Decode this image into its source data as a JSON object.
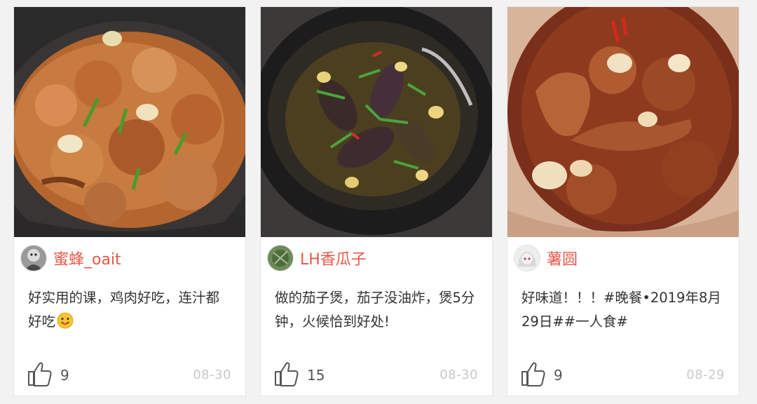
{
  "posts": [
    {
      "author": "蜜蜂_oait",
      "caption": "好实用的课，鸡肉好吃，连汁都好吃",
      "emoji": "grinning-emoji",
      "likes": "9",
      "date": "08-30",
      "photo": "chicken-claypot-photo"
    },
    {
      "author": "LH香瓜子",
      "caption": "做的茄子煲，茄子没油炸，煲5分钟，火候恰到好处!",
      "likes": "15",
      "date": "08-30",
      "photo": "eggplant-claypot-photo"
    },
    {
      "author": "薯圆",
      "caption": "好味道！！！#晚餐•2019年8月29日##一人食#",
      "likes": "9",
      "date": "08-29",
      "photo": "braised-duck-photo"
    }
  ],
  "colors": {
    "author": "#e8584a",
    "text": "#333333",
    "muted": "#c8c8c8",
    "background": "#f2f2f2",
    "card": "#ffffff"
  },
  "icons": {
    "like": "thumbs-up-icon"
  }
}
